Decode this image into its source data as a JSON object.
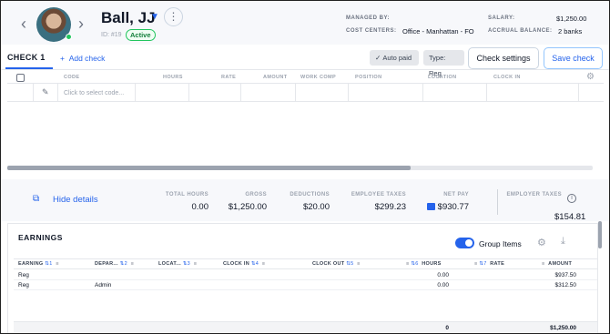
{
  "header": {
    "employee_name": "Ball, JJ",
    "employee_id": "ID: #19",
    "status_badge": "Active",
    "managed_by_label": "MANAGED BY:",
    "managed_by_value": "",
    "cost_centers_label": "COST CENTERS:",
    "cost_centers_value": "Office - Manhattan - FO",
    "salary_label": "SALARY:",
    "salary_value": "$1,250.00",
    "accrual_balance_label": "ACCRUAL BALANCE:",
    "accrual_balance_value": "2 banks"
  },
  "toolbar": {
    "active_tab": "CHECK 1",
    "add_check": "Add check",
    "auto_paid": "Auto paid",
    "type": "Type: Reg",
    "check_settings": "Check settings",
    "save_check": "Save check"
  },
  "check_grid": {
    "columns": [
      "CODE",
      "HOURS",
      "RATE",
      "AMOUNT",
      "WORK COMP",
      "POSITION",
      "LOCATION",
      "CLOCK IN"
    ],
    "code_placeholder": "Click to select code..."
  },
  "summary": {
    "hide_details": "Hide details",
    "total_hours_label": "TOTAL HOURS",
    "total_hours": "0.00",
    "gross_label": "GROSS",
    "gross": "$1,250.00",
    "deductions_label": "DEDUCTIONS",
    "deductions": "$20.00",
    "employee_taxes_label": "EMPLOYEE TAXES",
    "employee_taxes": "$299.23",
    "net_pay_label": "NET PAY",
    "net_pay": "$930.77",
    "employer_taxes_label": "EMPLOYER TAXES",
    "employer_taxes": "$154.81"
  },
  "earnings": {
    "title": "EARNINGS",
    "group_items_label": "Group Items",
    "group_items_on": true,
    "columns": {
      "earning": "EARNING",
      "earning_sort": "1",
      "department": "DEPAR...",
      "department_sort": "2",
      "location": "LOCAT...",
      "location_sort": "3",
      "clock_in": "CLOCK IN",
      "clock_in_sort": "4",
      "clock_out": "CLOCK OUT",
      "clock_out_sort": "5",
      "hours_sort": "6",
      "hours": "HOURS",
      "rate_sort": "7",
      "rate": "RATE",
      "amount": "AMOUNT"
    },
    "rows": [
      {
        "earning": "Reg",
        "department": "",
        "hours": "0.00",
        "amount": "$937.50"
      },
      {
        "earning": "Reg",
        "department": "Admin",
        "hours": "0.00",
        "amount": "$312.50"
      }
    ],
    "totals": {
      "hours": "0",
      "amount": "$1,250.00"
    }
  }
}
